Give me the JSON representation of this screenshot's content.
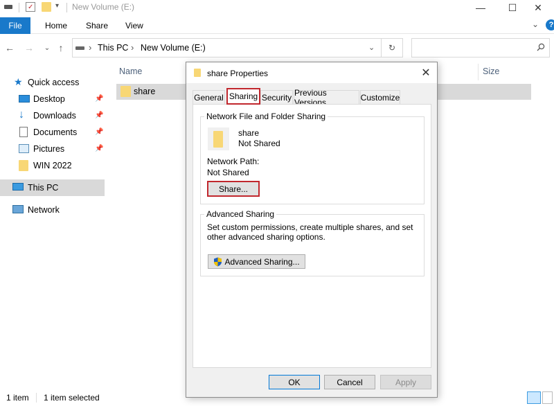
{
  "window": {
    "title": "New Volume (E:)",
    "controls": {
      "minimize": "—",
      "maximize": "☐",
      "close": "✕"
    }
  },
  "ribbon": {
    "file": "File",
    "tabs": [
      "Home",
      "Share",
      "View"
    ],
    "help": "?"
  },
  "address": {
    "crumbs": [
      "This PC",
      "New Volume (E:)"
    ],
    "separator": "›",
    "search_placeholder": ""
  },
  "nav": {
    "quick_access": "Quick access",
    "items": [
      {
        "label": "Desktop",
        "pinned": true,
        "icon": "desktop-icon"
      },
      {
        "label": "Downloads",
        "pinned": true,
        "icon": "downloads-icon"
      },
      {
        "label": "Documents",
        "pinned": true,
        "icon": "documents-icon"
      },
      {
        "label": "Pictures",
        "pinned": true,
        "icon": "pictures-icon"
      },
      {
        "label": "WIN 2022",
        "pinned": false,
        "icon": "folder-icon"
      }
    ],
    "this_pc": "This PC",
    "network": "Network",
    "pin_glyph": "📌"
  },
  "files": {
    "columns": {
      "name": "Name",
      "size": "Size"
    },
    "rows": [
      {
        "name": "share"
      }
    ]
  },
  "status": {
    "count": "1 item",
    "selected": "1 item selected"
  },
  "dialog": {
    "title": "share Properties",
    "close": "✕",
    "tabs": [
      "General",
      "Sharing",
      "Security",
      "Previous Versions",
      "Customize"
    ],
    "active_tab": "Sharing",
    "network_group": {
      "label": "Network File and Folder Sharing",
      "folder_name": "share",
      "folder_status": "Not Shared",
      "path_label": "Network Path:",
      "path_value": "Not Shared",
      "share_button": "Share..."
    },
    "advanced_group": {
      "label": "Advanced Sharing",
      "description": "Set custom permissions, create multiple shares, and set other advanced sharing options.",
      "button": "Advanced Sharing..."
    },
    "buttons": {
      "ok": "OK",
      "cancel": "Cancel",
      "apply": "Apply"
    }
  },
  "colors": {
    "accent": "#1979ca",
    "highlight": "#c1272d",
    "folder": "#f8d775"
  }
}
